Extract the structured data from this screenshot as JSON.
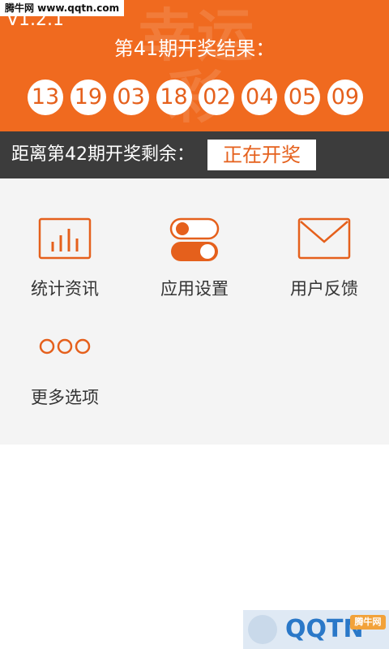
{
  "watermark_top": "腾牛网 www.qqtn.com",
  "header": {
    "version": "V1.2.1",
    "deco_text": "幸运彩",
    "title": "第41期开奖结果：",
    "numbers": [
      "13",
      "19",
      "03",
      "18",
      "02",
      "04",
      "05",
      "09"
    ],
    "bg_color": "#f06a1f"
  },
  "countdown": {
    "label": "距离第42期开奖剩余：",
    "status": "正在开奖"
  },
  "menu": {
    "items": [
      {
        "label": "统计资讯",
        "icon": "chart-icon"
      },
      {
        "label": "应用设置",
        "icon": "toggle-icon"
      },
      {
        "label": "用户反馈",
        "icon": "mail-icon"
      },
      {
        "label": "更多选项",
        "icon": "more-icon"
      }
    ]
  },
  "watermark_bottom": {
    "name": "QQTN",
    "badge": "腾牛网"
  }
}
